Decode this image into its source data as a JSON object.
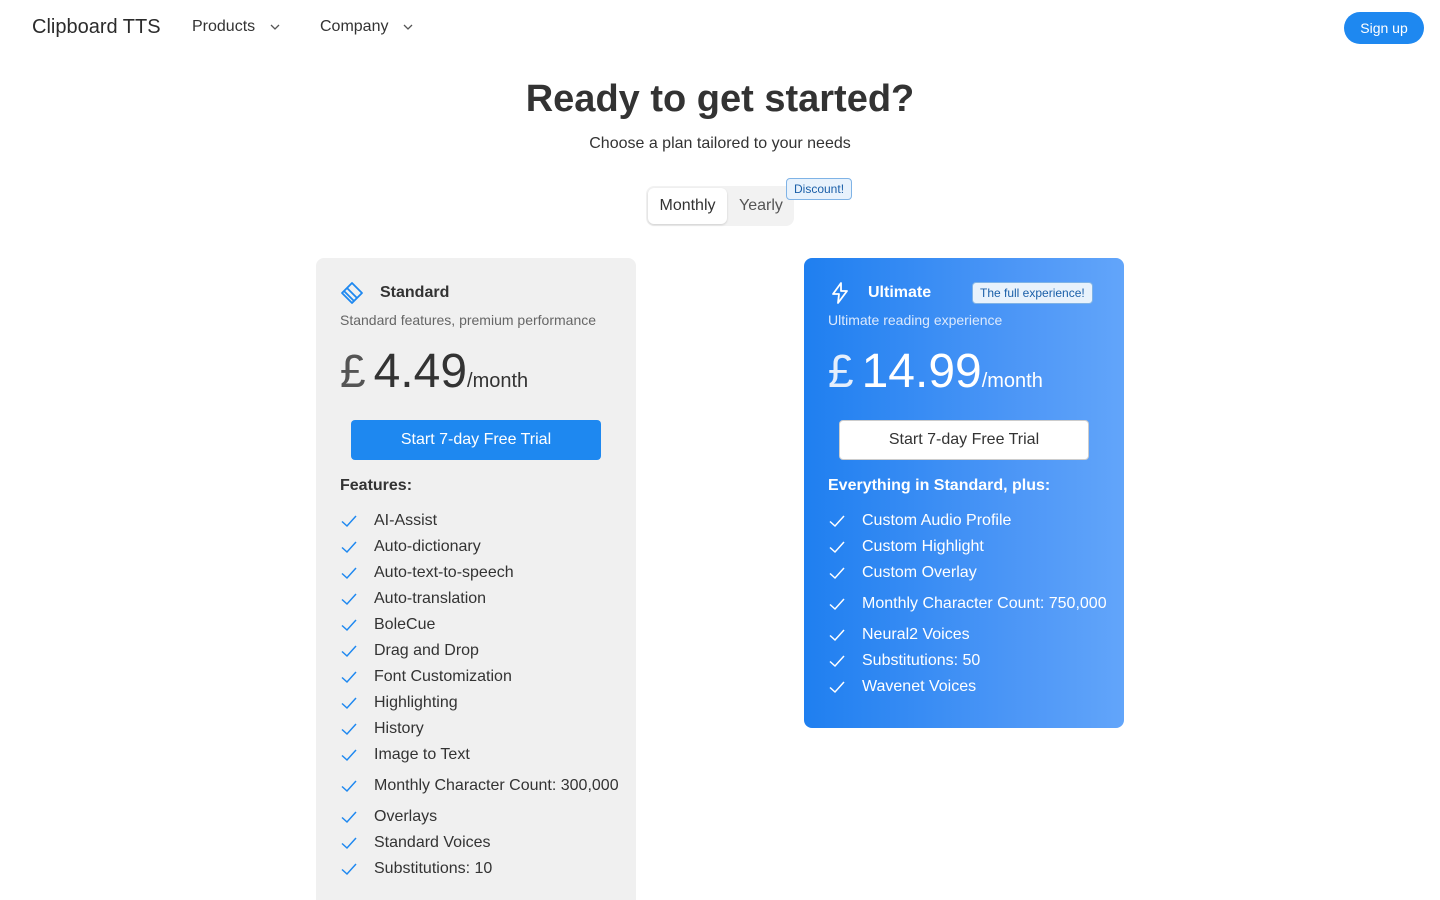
{
  "nav": {
    "brand": "Clipboard TTS",
    "products": "Products",
    "company": "Company",
    "signup": "Sign up"
  },
  "hero": {
    "title": "Ready to get started?",
    "subtitle": "Choose a plan tailored to your needs"
  },
  "billing_toggle": {
    "monthly": "Monthly",
    "yearly": "Yearly",
    "selected": "Monthly",
    "discount_badge": "Discount!"
  },
  "plans": {
    "standard": {
      "name": "Standard",
      "description": "Standard features, premium performance",
      "currency": "£",
      "amount": "4.49",
      "period": "/month",
      "cta": "Start 7-day Free Trial",
      "features_heading": "Features:",
      "features": [
        "AI-Assist",
        "Auto-dictionary",
        "Auto-text-to-speech",
        "Auto-translation",
        "BoleCue",
        "Drag and Drop",
        "Font Customization",
        "Highlighting",
        "History",
        "Image to Text",
        "Monthly Character Count: 300,000",
        "Overlays",
        "Standard Voices",
        "Substitutions: 10"
      ],
      "icon": "layers-icon"
    },
    "ultimate": {
      "name": "Ultimate",
      "badge": "The full experience!",
      "description": "Ultimate reading experience",
      "currency": "£",
      "amount": "14.99",
      "period": "/month",
      "cta": "Start 7-day Free Trial",
      "features_heading": "Everything in Standard, plus:",
      "features": [
        "Custom Audio Profile",
        "Custom Highlight",
        "Custom Overlay",
        "Monthly Character Count: 750,000",
        "Neural2 Voices",
        "Substitutions: 50",
        "Wavenet Voices"
      ],
      "icon": "lightning-icon"
    }
  },
  "colors": {
    "accent": "#1e88f0",
    "standard_card_bg": "#f0f0f0",
    "ultimate_gradient_start": "#1f7ff0",
    "ultimate_gradient_end": "#62a5fa"
  }
}
